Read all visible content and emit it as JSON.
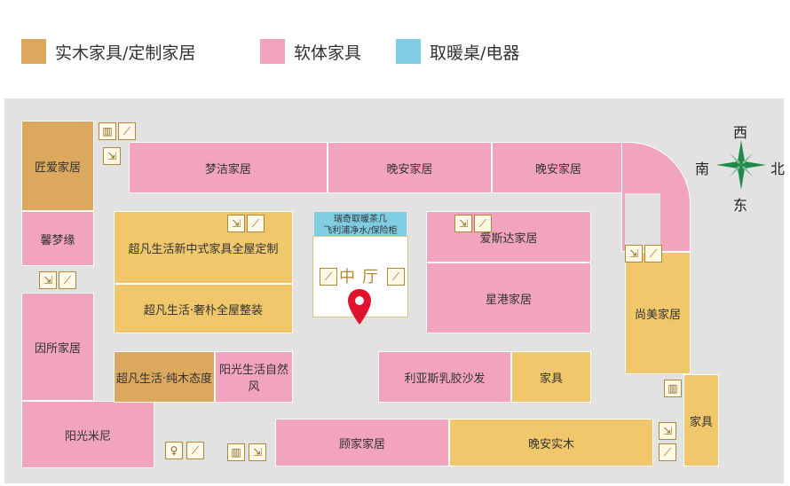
{
  "legend": [
    {
      "label": "实木家具/定制家居",
      "color": "#dba85d"
    },
    {
      "label": "软体家具",
      "color": "#f2a3bd"
    },
    {
      "label": "取暖桌/电器",
      "color": "#7ecde2"
    }
  ],
  "stores": {
    "jiangai": "匠爱家居",
    "xinmengyuan": "馨梦缘",
    "yinsuo": "因所家居",
    "yangguangmini": "阳光米尼",
    "mengjie": "梦洁家居",
    "wanan_top1": "晚安家居",
    "wanan_top2": "晚安家居",
    "chaofan_xinzhongshi": "超凡生活新中式家具全屋定制",
    "chaofan_shepu": "超凡生活·奢朴全屋整装",
    "chaofan_chunmu": "超凡生活·纯木态度",
    "yangguang_ziranfeng": "阳光生活自然风",
    "aisida": "爱斯达家居",
    "xinggang": "星港家居",
    "liyasi": "利亚斯乳胶沙发",
    "jiaju_mid": "家具",
    "shangmei": "尚美家居",
    "jiaju_right": "家具",
    "gujia": "顾家家居",
    "wanan_shimu": "晚安实木"
  },
  "center": {
    "banner_line1": "瑞奇取暖茶几",
    "banner_line2": "飞利浦净水/保险柜",
    "hall_title": "中厅"
  },
  "compass": {
    "north": "北",
    "south": "南",
    "east": "东",
    "west": "西"
  },
  "colors": {
    "pink": "#f2a3bd",
    "gold": "#f0c76a",
    "brown": "#dba85d",
    "blue": "#7ecde2",
    "marker": "#e0112b",
    "compass": "#1f8a4c"
  },
  "icons": [
    "elevator-icon",
    "escalator-icon",
    "fire-exit-icon",
    "restroom-icon",
    "location-pin-icon",
    "compass-icon"
  ]
}
